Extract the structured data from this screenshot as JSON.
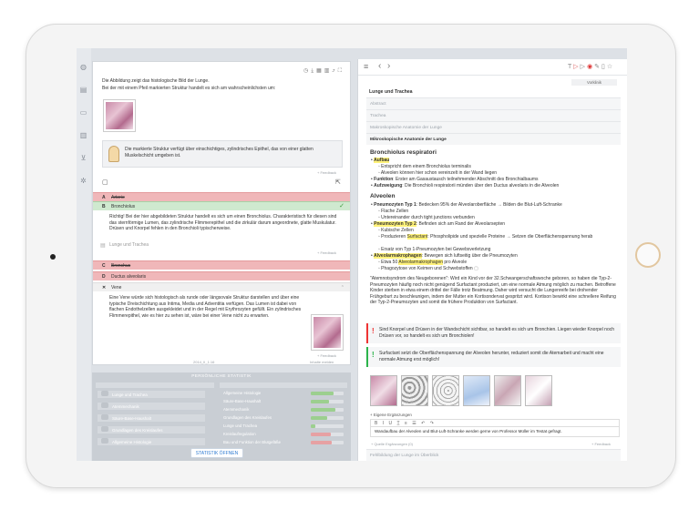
{
  "left_rail": {
    "icons": [
      "globe-icon",
      "book-icon",
      "clipboard-icon",
      "chart-icon",
      "cart-icon",
      "gear-icon"
    ]
  },
  "question": {
    "intro": "Die Abbildung zeigt das histologische Bild der Lunge.",
    "prompt": "Bei der mit einem Pfeil markierten Struktur handelt es sich am wahrscheinlichsten um:",
    "hint_text": "Die markierte Struktur verfügt über einschichtiges, zylindrisches Epithel, das von einer glatten Muskelschicht umgeben ist.",
    "feedback": "+ Feedback",
    "answers": [
      {
        "letter": "A",
        "label": "Arterie",
        "state": "wrong"
      },
      {
        "letter": "B",
        "label": "Bronchiolus",
        "state": "right"
      },
      {
        "letter": "C",
        "label": "Bronchus",
        "state": "wrong"
      },
      {
        "letter": "D",
        "label": "Ductus alveolaris",
        "state": "wrong"
      },
      {
        "letter": "E",
        "label": "Vene",
        "state": "wrong"
      }
    ],
    "explanation_b": "Richtig! Bei der hier abgebildeten Struktur handelt es sich um einen Bronchiolus. Charakteristisch für diesen sind das sternförmige Lumen, das zylindrische Flimmerepithel und die zirkulär darum angeordnete, glatte Muskulatur. Drüsen und Knorpel fehlen in den Bronchioli typischerweise.",
    "link_b": "Lunge und Trachea",
    "explanation_e": "Eine Vene würde sich histologisch als runde oder längsovale Struktur darstellen und über eine typische Dreischichtung aus Intima, Media und Adventitia verfügen. Das Lumen ist dabei von flachen Endothelzellen ausgekleidet und in der Regel mit Erythrozyten gefüllt. Ein zylindrisches Flimmerepithel, wie es hier zu sehen ist, wäre bei einer Vene nicht zu erwarten.",
    "footer": "2014_II_1.16",
    "footer_right": "Inhalte melden"
  },
  "stats": {
    "title": "PERSÖNLICHE STATISTIK",
    "left_items": [
      "Lunge und Trachea",
      "Atemmechanik",
      "Säure-Base-Haushalt",
      "Grundlagen des Kreislaufes",
      "Allgemeine Histologie"
    ],
    "right_items": [
      {
        "label": "Allgemeine Histologie",
        "level": 0.7,
        "color": "#9ccf8f"
      },
      {
        "label": "Säure-Base-Haushalt",
        "level": 0.55,
        "color": "#9ccf8f"
      },
      {
        "label": "Atemmechanik",
        "level": 0.75,
        "color": "#9ccf8f"
      },
      {
        "label": "Grundlagen des Kreislaufes",
        "level": 0.5,
        "color": "#9ccf8f"
      },
      {
        "label": "Lunge und Trachea",
        "level": 0.15,
        "color": "#9ccf8f"
      },
      {
        "label": "Kreislaufregulation",
        "level": 0.6,
        "color": "#e6a1a3"
      },
      {
        "label": "Bau und Funktion der Blutgefäße",
        "level": 0.65,
        "color": "#e6a1a3"
      }
    ],
    "button": "STATISTIK ÖFFNEN"
  },
  "reader": {
    "badge": "Vorklinik",
    "chapter_title": "Lunge und Trachea",
    "sections": [
      {
        "label": "Abstract",
        "state": "dim"
      },
      {
        "label": "Trachea",
        "state": "dim"
      },
      {
        "label": "Makroskopische Anatomie der Lunge",
        "state": "dim"
      },
      {
        "label": "Mikroskopische Anatomie der Lunge",
        "state": "act"
      }
    ],
    "h_bronch": "Bronchiolus respiratori",
    "b1_label": "Aufbau",
    "b1_items": [
      "Entspricht dem einem Bronchiolus terminalis",
      "Alveolen können hier schon vereinzelt in der Wand liegen"
    ],
    "b2_label": "Funktion",
    "b2_text": ": Erster am Gasaustausch teilnehmender Abschnitt des Bronchialbaums",
    "b3_label": "Aufzweigung",
    "b3_text": ": Die Bronchioli respiratorii münden über den Ductus alveolaris in die Alveolen",
    "h_alv": "Alveolen",
    "p1_label": "Pneumozyten Typ 1",
    "p1_text": ": Bedecken 95% der Alveolaroberfläche → Bilden die Blut-Luft-Schranke",
    "p1_items": [
      "Flache Zellen",
      "Untereinander durch tight junctions verbunden"
    ],
    "p2_label": "Pneumozyten Typ 2",
    "p2_text": ": Befinden sich am Rand der Alveolarsepten",
    "p2_items": [
      "Kubische Zellen",
      "Ersatz von Typ 1-Pneumozyten bei Gewebsverletzung"
    ],
    "p2_surf_pre": "Produzieren ",
    "p2_surf": "Surfactant",
    "p2_surf_post": ": Phospholipide und spezielle Proteine → Setzen die Oberflächenspannung herab",
    "am_label": "Alveolarmakrophagen",
    "am_text": ": Bewegen sich luftseitig über die Pneumozyten",
    "am_item1_pre": "Etwa 50 ",
    "am_item1_hl": "Alveolarmakrophagen",
    "am_item1_post": " pro Alveole",
    "am_item2": "Phagozytose von Keimen und Schwebstoffen",
    "para": "\"Atemnotsyndrom des Neugeborenen\": Wird ein Kind vor der 32.Schwangerschaftswoche geboren, so haben die Typ-2-Pneumozyten häufig noch nicht genügend Surfactant produziert, um eine normale Atmung möglich zu machen. Betroffene Kinder sterben in etwa einem drittel der Fälle trotz Beatmung. Daher wird versucht die Lungenreife bei drohender Frühgeburt zu beschleunigen, indem der Mutter ein Kortisondervat gespritzt wird. Kortison bewirkt eine schnellere Reifung der Typ-2-Pneumozyten und somit die frühere Produktion von Surfactant.",
    "note_red": "Sind Knorpel und Drüsen in der Wandschicht sichtbar, so handelt es sich um Bronchien. Liegen wieder Knorpel noch Drüsen vor, so handelt es sich um Bronchiolen!",
    "note_green": "Surfactant setzt die Oberflächenspannung der Alveolen herunter, reduziert somit die Atemarbeit und macht eine normale Atmung erst möglich!",
    "own_label": "+ Eigene Ergänzungen",
    "editor_tools": [
      "B",
      "I",
      "U",
      "T̲",
      "≡",
      "☰",
      "↶",
      "↷"
    ],
    "own_text": "Wandaufbau der Alveolen und Blut-Luft-Schranke werden gerne von Professor Müller im Testat gefragt.",
    "own_footer": "+ Quelle Ergänzungen (0)",
    "feedback": "+ Feedback",
    "bottom_section": "Fehlbildung der Lunge im Überblick"
  },
  "colors": {
    "wrong": "#f0b7b9",
    "right": "#cfe9cf",
    "highlight": "#fff27a",
    "accent": "#2f7bd1"
  }
}
